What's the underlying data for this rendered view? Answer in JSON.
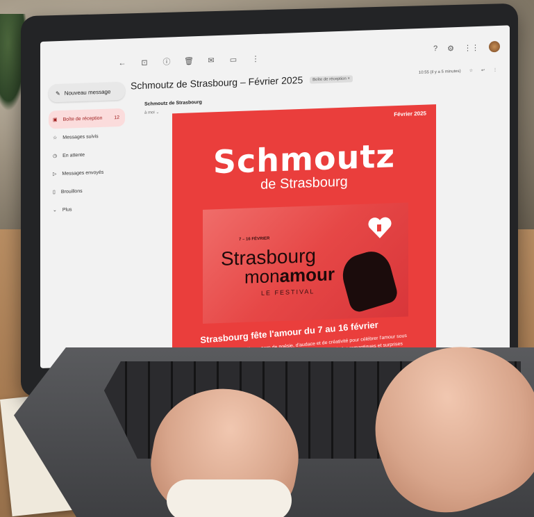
{
  "email_app": {
    "compose_label": "Nouveau message",
    "sidebar": [
      {
        "icon": "inbox-icon",
        "label": "Boîte de réception",
        "count": "12",
        "active": true
      },
      {
        "icon": "star-icon",
        "label": "Messages suivis"
      },
      {
        "icon": "clock-icon",
        "label": "En attente"
      },
      {
        "icon": "send-icon",
        "label": "Messages envoyés"
      },
      {
        "icon": "draft-icon",
        "label": "Brouillons"
      },
      {
        "icon": "chevron-down-icon",
        "label": "Plus"
      }
    ],
    "subject": "Schmoutz de Strasbourg – Février 2025",
    "label_badge": "Boîte de réception ×",
    "sender": "Schmoutz de Strasbourg",
    "recipient": "à moi ⌄",
    "time": "10:55 (il y a 5 minutes)"
  },
  "newsletter": {
    "date": "Février 2025",
    "brand": "Schmoutz",
    "brand_sub": "de Strasbourg",
    "feature_dates": "7 – 16 FÉVRIER",
    "feature_title_1": "Strasbourg",
    "feature_title_2a": "mon",
    "feature_title_2b": "amour",
    "feature_label": "LE FESTIVAL",
    "headline": "Strasbourg fête l'amour du 7 au 16 février",
    "body": "Pendant 10 jours, la ville se pare de poésie, d'audace et de créativité pour célébrer l'amour sous toutes ses formes. Soirées envoûtantes, concerts intimistes, balades romantiques et surprises artistiques vous attendent."
  },
  "colors": {
    "poster_red": "#ea3e3c",
    "inbox_active_bg": "#fbdcdc"
  }
}
